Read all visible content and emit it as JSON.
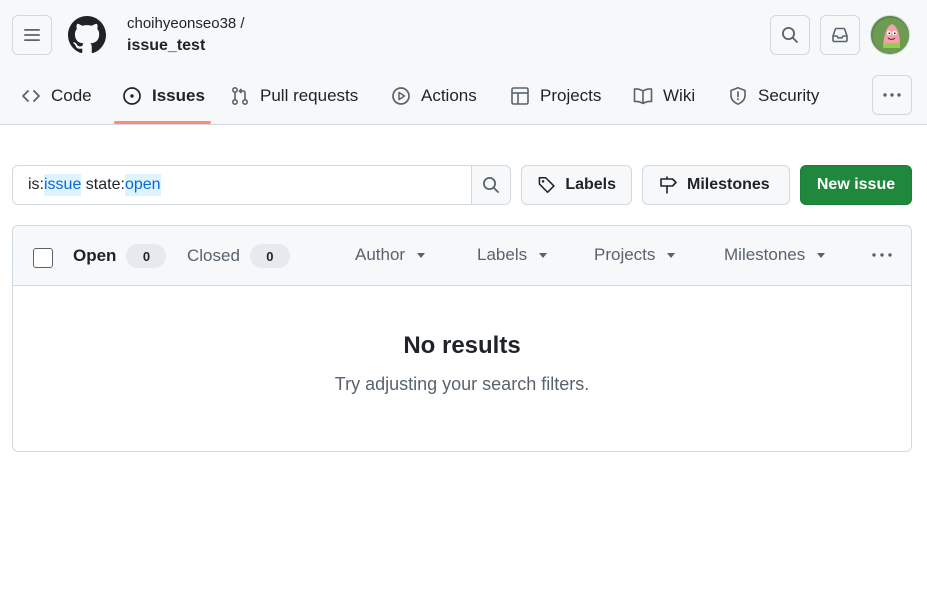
{
  "header": {
    "owner": "choihyeonseo38 /",
    "repo": "issue_test",
    "icons": {
      "menu": "hamburger-menu-icon",
      "logo": "github-mark-icon",
      "search": "search-icon",
      "inbox": "inbox-icon",
      "more": "kebab-horizontal-icon"
    }
  },
  "nav": {
    "tabs": [
      {
        "label": "Code",
        "icon": "code-icon"
      },
      {
        "label": "Issues",
        "icon": "issue-opened-icon",
        "active": true
      },
      {
        "label": "Pull requests",
        "icon": "git-pull-request-icon"
      },
      {
        "label": "Actions",
        "icon": "play-icon"
      },
      {
        "label": "Projects",
        "icon": "table-icon"
      },
      {
        "label": "Wiki",
        "icon": "book-icon"
      },
      {
        "label": "Security",
        "icon": "shield-icon"
      }
    ]
  },
  "filter": {
    "prefix1": "is:",
    "token1": "issue",
    "prefix2": " state:",
    "token2": "open"
  },
  "buttons": {
    "labels": "Labels",
    "milestones": "Milestones",
    "new_issue": "New issue"
  },
  "list": {
    "open_label": "Open",
    "open_count": "0",
    "closed_label": "Closed",
    "closed_count": "0",
    "filters": [
      "Author",
      "Labels",
      "Projects",
      "Milestones"
    ]
  },
  "empty": {
    "title": "No results",
    "description": "Try adjusting your search filters."
  },
  "colors": {
    "primary_button": "#1f883d",
    "active_tab_underline": "#fd8c73",
    "filter_highlight": "#ddf4ff",
    "link": "#0969da"
  }
}
